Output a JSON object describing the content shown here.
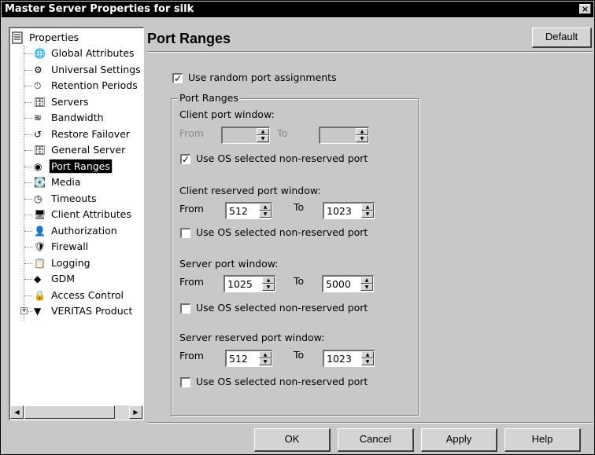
{
  "window": {
    "title": "Master Server Properties for silk",
    "close_label": "×"
  },
  "tree": {
    "root": "Properties",
    "items": [
      {
        "label": "Global Attributes",
        "icon": "globe-icon"
      },
      {
        "label": "Universal Settings",
        "icon": "settings-icon"
      },
      {
        "label": "Retention Periods",
        "icon": "clock-icon"
      },
      {
        "label": "Servers",
        "icon": "server-icon"
      },
      {
        "label": "Bandwidth",
        "icon": "bandwidth-icon"
      },
      {
        "label": "Restore Failover",
        "icon": "restore-icon"
      },
      {
        "label": "General Server",
        "icon": "server-icon"
      },
      {
        "label": "Port Ranges",
        "icon": "port-icon",
        "selected": true
      },
      {
        "label": "Media",
        "icon": "media-icon"
      },
      {
        "label": "Timeouts",
        "icon": "timer-icon"
      },
      {
        "label": "Client Attributes",
        "icon": "client-icon"
      },
      {
        "label": "Authorization",
        "icon": "user-key-icon"
      },
      {
        "label": "Firewall",
        "icon": "firewall-icon"
      },
      {
        "label": "Logging",
        "icon": "log-icon"
      },
      {
        "label": "GDM",
        "icon": "gdm-icon"
      },
      {
        "label": "Access Control",
        "icon": "access-control-icon"
      },
      {
        "label": "VERITAS Product",
        "icon": "veritas-icon"
      }
    ]
  },
  "panel": {
    "title": "Port Ranges",
    "default_button": "Default",
    "use_random": {
      "label": "Use random port assignments",
      "checked": true
    },
    "group_label": "Port Ranges",
    "client_port": {
      "label": "Client port window:",
      "from_label": "From",
      "to_label": "To",
      "from": "",
      "to": "",
      "os_label": "Use OS selected non-reserved port",
      "os_checked": true
    },
    "client_reserved": {
      "label": "Client reserved port window:",
      "from_label": "From",
      "to_label": "To",
      "from": "512",
      "to": "1023",
      "os_label": "Use OS selected non-reserved port",
      "os_checked": false
    },
    "server_port": {
      "label": "Server port window:",
      "from_label": "From",
      "to_label": "To",
      "from": "1025",
      "to": "5000",
      "os_label": "Use OS selected non-reserved port",
      "os_checked": false
    },
    "server_reserved": {
      "label": "Server reserved port window:",
      "from_label": "From",
      "to_label": "To",
      "from": "512",
      "to": "1023",
      "os_label": "Use OS selected non-reserved port",
      "os_checked": false
    }
  },
  "footer": {
    "ok": "OK",
    "cancel": "Cancel",
    "apply": "Apply",
    "help": "Help"
  }
}
